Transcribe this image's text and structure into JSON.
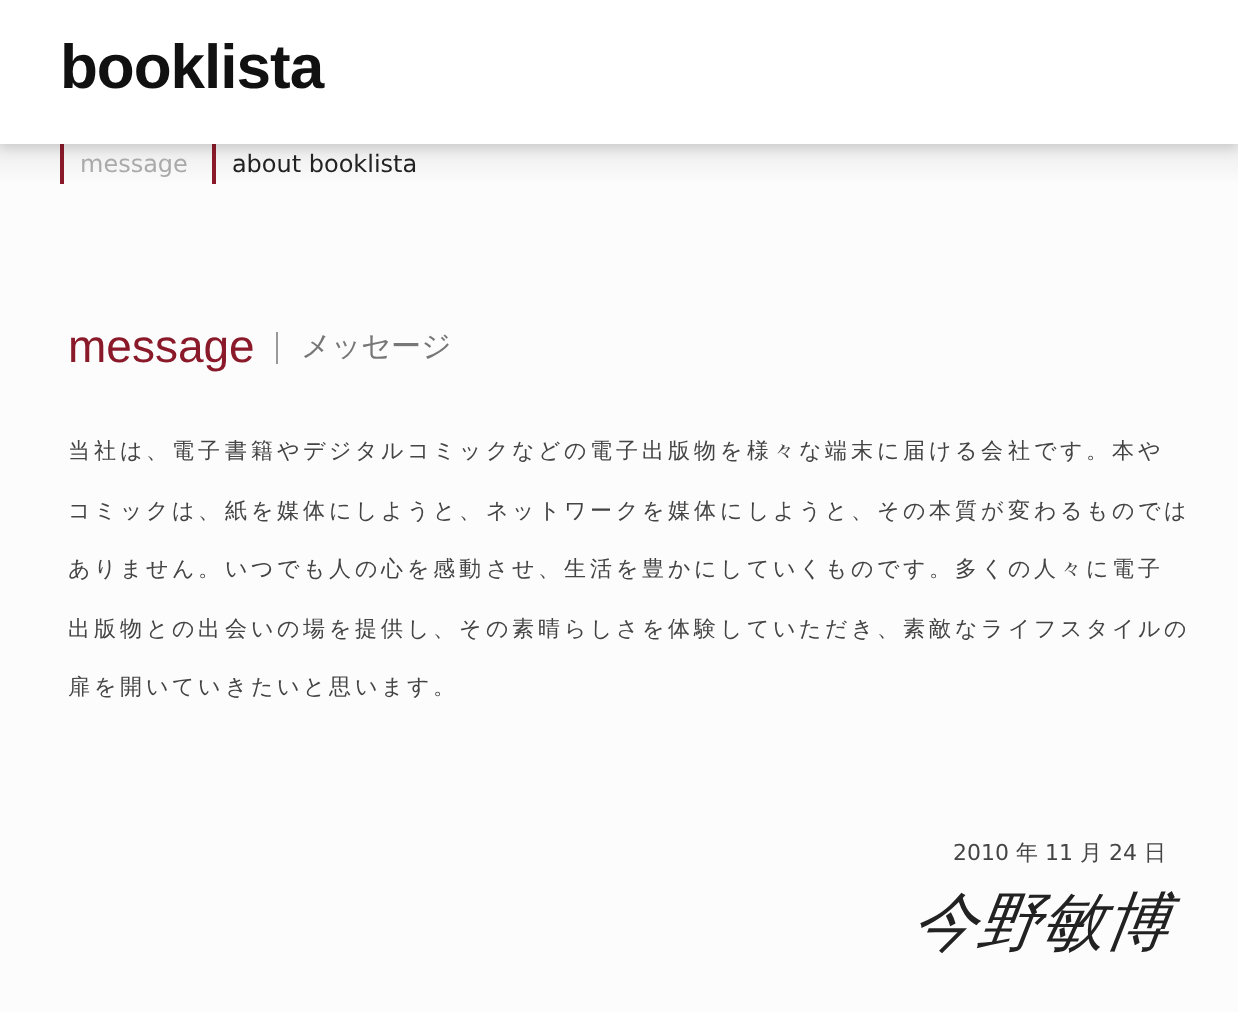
{
  "logo": "booklista",
  "nav": [
    {
      "label": "message",
      "selected": true
    },
    {
      "label": "about booklista",
      "selected": false
    }
  ],
  "heading": {
    "title": "message",
    "subtitle": "メッセージ"
  },
  "body_lines": [
    "当社は、電子書籍やデジタルコミックなどの電子出版物を様々な端末に届ける会社です。本や",
    "コミックは、紙を媒体にしようと、ネットワークを媒体にしようと、その本質が変わるものでは",
    "ありません。いつでも人の心を感動させ、生活を豊かにしていくものです。多くの人々に電子",
    "出版物との出会いの場を提供し、その素晴らしさを体験していただき、素敵なライフスタイルの",
    "扉を開いていきたいと思います。"
  ],
  "date": "2010 年 11 月 24 日",
  "signature": "今野敏博"
}
